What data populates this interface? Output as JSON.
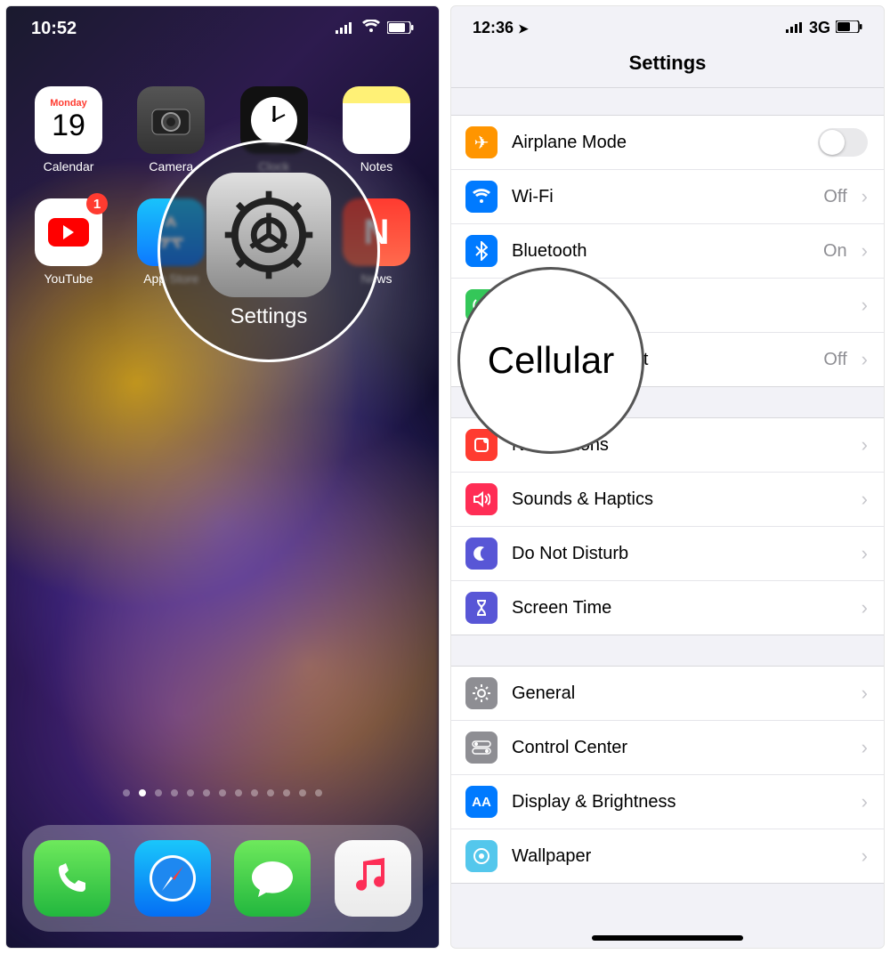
{
  "left": {
    "statusbar": {
      "time": "10:52",
      "location_arrow": "➤"
    },
    "apps_row1": [
      {
        "label": "Calendar",
        "day": "Monday",
        "num": "19"
      },
      {
        "label": "Camera"
      },
      {
        "label": "Clock"
      },
      {
        "label": "Notes"
      }
    ],
    "apps_row2": [
      {
        "label": "YouTube",
        "badge": "1"
      },
      {
        "label": "App Store"
      },
      {
        "label": "Settings"
      },
      {
        "label": "News"
      }
    ],
    "magnifier_label": "Settings",
    "page_dot_count": 13,
    "page_dot_active": 1,
    "dock": [
      "Phone",
      "Safari",
      "Messages",
      "Music"
    ]
  },
  "right": {
    "statusbar": {
      "time": "12:36",
      "network": "3G"
    },
    "title": "Settings",
    "group1": [
      {
        "icon": "airplane",
        "label": "Airplane Mode",
        "toggle": false
      },
      {
        "icon": "wifi",
        "label": "Wi-Fi",
        "value": "Off"
      },
      {
        "icon": "bluetooth",
        "label": "Bluetooth",
        "value": "On"
      },
      {
        "icon": "cellular",
        "label": "Cellular"
      },
      {
        "icon": "hotspot",
        "label": "Personal Hotspot",
        "value": "Off"
      }
    ],
    "group2": [
      {
        "icon": "notifications",
        "label": "Notifications"
      },
      {
        "icon": "sounds",
        "label": "Sounds & Haptics"
      },
      {
        "icon": "dnd",
        "label": "Do Not Disturb"
      },
      {
        "icon": "screentime",
        "label": "Screen Time"
      }
    ],
    "group3": [
      {
        "icon": "general",
        "label": "General"
      },
      {
        "icon": "controlcenter",
        "label": "Control Center"
      },
      {
        "icon": "display",
        "label": "Display & Brightness"
      },
      {
        "icon": "wallpaper",
        "label": "Wallpaper"
      }
    ],
    "magnifier_label": "Cellular"
  }
}
